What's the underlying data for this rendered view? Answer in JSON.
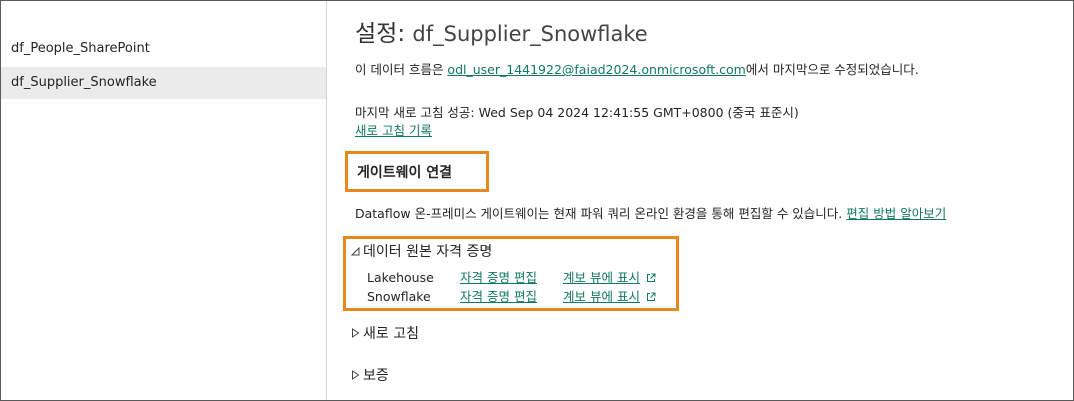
{
  "sidebar": {
    "items": [
      {
        "label": "df_People_SharePoint",
        "selected": false
      },
      {
        "label": "df_Supplier_Snowflake",
        "selected": true
      }
    ]
  },
  "header": {
    "title_key": "설정:",
    "title_value": "df_Supplier_Snowflake"
  },
  "info": {
    "modified_prefix": "이 데이터 흐름은 ",
    "modified_user": "odl_user_1441922@faiad2024.onmicrosoft.com",
    "modified_suffix": "에서 마지막으로 수정되었습니다.",
    "refresh_status": "마지막 새로 고침 성공: Wed Sep 04 2024 12:41:55 GMT+0800 (중국 표준시)",
    "refresh_history_link": "새로 고침 기록"
  },
  "gateway": {
    "heading": "게이트웨이 연결",
    "description": "Dataflow 온-프레미스 게이트웨이는 현재 파워 쿼리 온라인 환경을 통해 편집할 수 있습니다.",
    "learn_link": "편집 방법 알아보기"
  },
  "credentials": {
    "section_title": "데이터 원본 자격 증명",
    "expanded_icon": "triangle-down-icon",
    "rows": [
      {
        "name": "Lakehouse",
        "edit": "자격 증명 편집",
        "view": "계보 뷰에 표시"
      },
      {
        "name": "Snowflake",
        "edit": "자격 증명 편집",
        "view": "계보 뷰에 표시"
      }
    ]
  },
  "sections": [
    {
      "title": "새로 고침",
      "icon": "triangle-right-icon"
    },
    {
      "title": "보증",
      "icon": "triangle-right-icon"
    }
  ],
  "colors": {
    "link": "#117865",
    "highlight_box": "#e8881a",
    "selected_bg": "#ebebeb"
  }
}
